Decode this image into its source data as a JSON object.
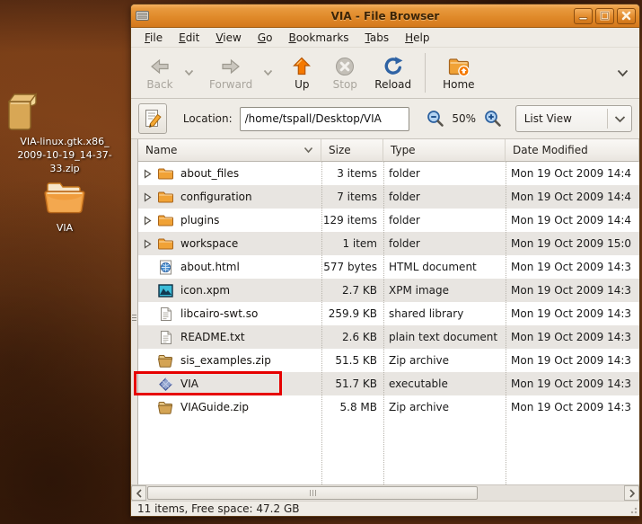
{
  "desktop": {
    "icons": [
      {
        "id": "zip-package",
        "icon": "package-zip-icon",
        "label": "VIA-linux.gtk.x86_\n2009-10-19_14-37-\n33.zip"
      },
      {
        "id": "via-folder",
        "icon": "desktop-folder-icon",
        "label": "VIA"
      }
    ]
  },
  "window": {
    "title": "VIA - File Browser",
    "controls": {
      "minimize": "minimize",
      "maximize": "maximize",
      "close": "close"
    },
    "menu": {
      "items": [
        "File",
        "Edit",
        "View",
        "Go",
        "Bookmarks",
        "Tabs",
        "Help"
      ]
    },
    "toolbar": {
      "buttons": [
        {
          "id": "back",
          "label": "Back",
          "disabled": true,
          "dropdown": true
        },
        {
          "id": "forward",
          "label": "Forward",
          "disabled": true,
          "dropdown": true
        },
        {
          "id": "up",
          "label": "Up",
          "disabled": false,
          "dropdown": false
        },
        {
          "id": "stop",
          "label": "Stop",
          "disabled": true,
          "dropdown": false
        },
        {
          "id": "reload",
          "label": "Reload",
          "disabled": false,
          "dropdown": false
        },
        {
          "id": "separator"
        },
        {
          "id": "home",
          "label": "Home",
          "disabled": false,
          "dropdown": false
        }
      ]
    },
    "location_bar": {
      "label": "Location:",
      "value": "/home/tspall/Desktop/VIA",
      "zoom_level": "50%",
      "view_mode": "List View"
    },
    "list": {
      "columns": [
        "Name",
        "Size",
        "Type",
        "Date Modified"
      ],
      "sorted_column": "Name",
      "rows": [
        {
          "name": "about_files",
          "size": "3 items",
          "type": "folder",
          "date": "Mon 19 Oct 2009 14:4",
          "icon": "folder",
          "expander": true,
          "annotated": false
        },
        {
          "name": "configuration",
          "size": "7 items",
          "type": "folder",
          "date": "Mon 19 Oct 2009 14:4",
          "icon": "folder",
          "expander": true,
          "annotated": false
        },
        {
          "name": "plugins",
          "size": "129 items",
          "type": "folder",
          "date": "Mon 19 Oct 2009 14:4",
          "icon": "folder",
          "expander": true,
          "annotated": false
        },
        {
          "name": "workspace",
          "size": "1 item",
          "type": "folder",
          "date": "Mon 19 Oct 2009 15:0",
          "icon": "folder",
          "expander": true,
          "annotated": false
        },
        {
          "name": "about.html",
          "size": "577 bytes",
          "type": "HTML document",
          "date": "Mon 19 Oct 2009 14:3",
          "icon": "html",
          "expander": false,
          "annotated": false
        },
        {
          "name": "icon.xpm",
          "size": "2.7 KB",
          "type": "XPM image",
          "date": "Mon 19 Oct 2009 14:3",
          "icon": "image",
          "expander": false,
          "annotated": false
        },
        {
          "name": "libcairo-swt.so",
          "size": "259.9 KB",
          "type": "shared library",
          "date": "Mon 19 Oct 2009 14:3",
          "icon": "doc",
          "expander": false,
          "annotated": false
        },
        {
          "name": "README.txt",
          "size": "2.6 KB",
          "type": "plain text document",
          "date": "Mon 19 Oct 2009 14:3",
          "icon": "doc",
          "expander": false,
          "annotated": false
        },
        {
          "name": "sis_examples.zip",
          "size": "51.5 KB",
          "type": "Zip archive",
          "date": "Mon 19 Oct 2009 14:3",
          "icon": "zip",
          "expander": false,
          "annotated": false
        },
        {
          "name": "VIA",
          "size": "51.7 KB",
          "type": "executable",
          "date": "Mon 19 Oct 2009 14:3",
          "icon": "exe",
          "expander": false,
          "annotated": true
        },
        {
          "name": "VIAGuide.zip",
          "size": "5.8 MB",
          "type": "Zip archive",
          "date": "Mon 19 Oct 2009 14:3",
          "icon": "zip",
          "expander": false,
          "annotated": false
        }
      ]
    },
    "status_bar": {
      "text": "11 items, Free space: 47.2 GB"
    }
  },
  "annotation": {
    "shape": "rectangle",
    "target_row": "VIA",
    "color": "#e60000"
  },
  "colors": {
    "titlebar_top": "#f3b061",
    "titlebar_bottom": "#d4781c",
    "accent_orange": "#f57900",
    "gtk_bg": "#efece6",
    "alt_row": "#e8e5e1",
    "annotation_red": "#e60000"
  }
}
